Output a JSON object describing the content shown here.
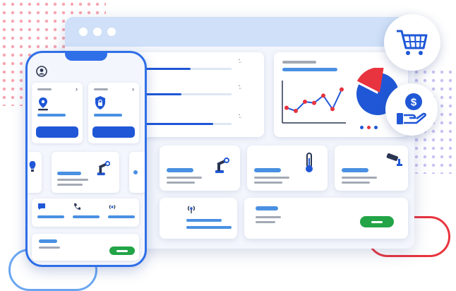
{
  "colors": {
    "accent_blue": "#1f57d6",
    "light_blue": "#cfe0f8",
    "chart_red": "#e8343f",
    "success_green": "#22a447",
    "decor_pink": "#f7a6b2",
    "decor_purple": "#c9c2f3"
  },
  "icons": {
    "cart": "shopping-cart-icon",
    "payment": "dollar-hand-icon",
    "profile": "user-avatar-icon",
    "location": "location-pin-icon",
    "security": "lock-shield-icon",
    "robot": "robot-arm-icon",
    "thermometer": "thermometer-icon",
    "camera": "security-camera-icon",
    "chat": "chat-icon",
    "phone": "phone-call-icon",
    "signal": "antenna-signal-icon",
    "bulb": "lightbulb-icon"
  },
  "dashboard": {
    "progress_levels": [
      0.55,
      0.45,
      0.8
    ],
    "progress_unit_labels": [
      "·̤",
      "·̤",
      "·̤"
    ]
  },
  "chart_data": {
    "type": "line",
    "x": [
      1,
      2,
      3,
      4,
      5,
      6,
      7
    ],
    "values": [
      4,
      3.5,
      5,
      4.8,
      6,
      3.8,
      7
    ],
    "grid": false,
    "legend": "none"
  },
  "pie_data": {
    "type": "pie",
    "values": [
      80,
      20
    ]
  }
}
